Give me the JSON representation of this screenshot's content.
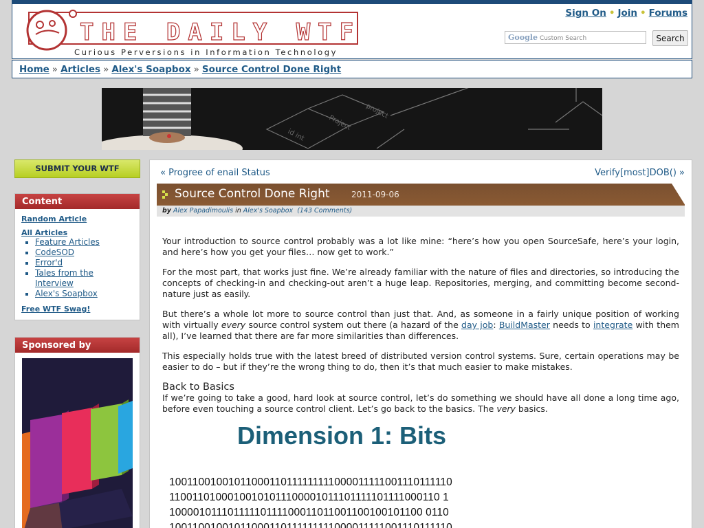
{
  "site": {
    "logo_text": "THE DAILY WTF",
    "tagline": "Curious Perversions in Information Technology"
  },
  "userlinks": {
    "sign_on": "Sign On",
    "join": "Join",
    "forums": "Forums",
    "sep": "•"
  },
  "search": {
    "placeholder": "Custom Search",
    "google": "Google",
    "button": "Search"
  },
  "breadcrumb": [
    "Home",
    "Articles",
    "Alex's Soapbox",
    "Source Control Done Right"
  ],
  "breadcrumb_sep": "»",
  "sidebar": {
    "submit": "SUBMIT YOUR WTF",
    "content_header": "Content",
    "random": "Random Article",
    "all_articles": "All Articles",
    "items": [
      "Feature Articles",
      "CodeSOD",
      "Error'd",
      "Tales from the Interview",
      "Alex's Soapbox"
    ],
    "swag": "Free WTF Swag!",
    "sponsored_header": "Sponsored by"
  },
  "nav": {
    "prev": "« Progree of enail Status",
    "next": "Verify[most]DOB() »"
  },
  "article": {
    "title": "Source Control Done Right",
    "date": "2011-09-06",
    "by": "by",
    "author": "Alex Papadimoulis",
    "in": "in",
    "category": "Alex's Soapbox",
    "comments": "(143 Comments)",
    "p1": "Your introduction to source control probably was a lot like mine: “here’s how you open SourceSafe, here’s your login, and here’s how you get your files… now get to work.”",
    "p2": "For the most part, that works just fine. We’re already familiar with the nature of files and directories, so introducing the concepts of checking-in and checking-out aren’t a huge leap. Repositories, merging, and committing become second-nature just as easily.",
    "p3_a": "But there’s a whole lot more to source control than just that. And, as someone in a fairly unique position of working with virtually ",
    "p3_em": "every",
    "p3_b": " source control system out there (a hazard of the ",
    "p3_link1": "day job",
    "p3_c": ": ",
    "p3_link2": "BuildMaster",
    "p3_d": " needs to ",
    "p3_link3": "integrate",
    "p3_e": " with them all), I’ve learned that there are far more similarities than differences.",
    "p4": "This especially holds true with the latest breed of distributed version control systems. Sure, certain operations may be easier to do – but if they’re the wrong thing to do, then it’s that much easier to make mistakes.",
    "h_basics": "Back to Basics",
    "p5_a": "If we’re going to take a good, hard look at source control, let’s do something we should have all done a long time ago, before even touching a source control client. Let’s go back to the basics. The ",
    "p5_em": "very",
    "p5_b": " basics.",
    "figure_title": "Dimension 1: Bits",
    "bits": "10011001001011000110111111111000011111001110111110\n11001101000100101011100001011101111101111000110 1\n10000101110111110111100011011001100100101100 0110\n10011001001011000110111111111000011111001110111110"
  },
  "colors": {
    "brand_blue": "#1d4b79",
    "title_brown": "#7a5030",
    "accent_green": "#c3d63a",
    "box_red": "#b33333"
  }
}
